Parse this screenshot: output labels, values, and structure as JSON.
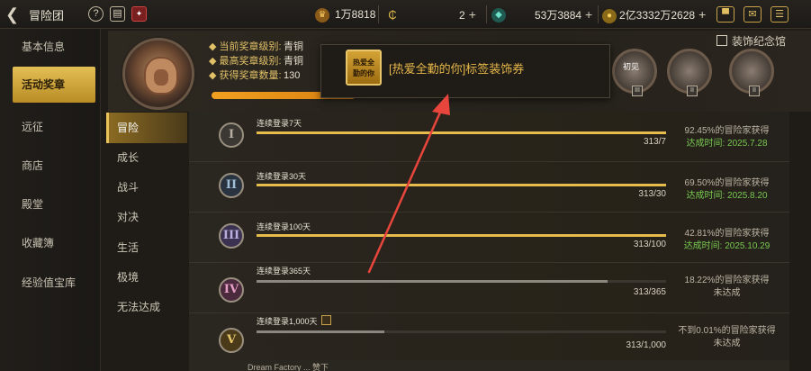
{
  "topbar": {
    "back_icon": "back-arrow-icon",
    "title": "冒险团",
    "help_glyph": "?",
    "book_glyph": "▤",
    "resources": [
      {
        "icon": "trophy-icon",
        "value": "1万8818",
        "color": "#e0a53a"
      },
      {
        "icon": "coin-c-icon",
        "glyph": "₵",
        "value": "2",
        "plus": "+",
        "color": "#d9b04a"
      },
      {
        "icon": "gem-icon",
        "value": "53万3884",
        "plus": "+",
        "color": "#3fb7a4"
      },
      {
        "icon": "gold-icon",
        "value": "2亿3332万2628",
        "plus": "+",
        "color": "#e0b33a"
      }
    ],
    "right_icons": [
      "treasure-icon",
      "mail-icon",
      "menu-icon"
    ]
  },
  "left_nav": {
    "items": [
      {
        "label": "基本信息"
      },
      {
        "label": "活动奖章",
        "active": true
      },
      {
        "label": "远征"
      },
      {
        "label": "商店"
      },
      {
        "label": "殿堂"
      },
      {
        "label": "收藏簿"
      },
      {
        "label": "经验值宝库"
      }
    ]
  },
  "header": {
    "current_rank_label": "当前奖章级别:",
    "current_rank_value": "青铜",
    "highest_rank_label": "最高奖章级别:",
    "highest_rank_value": "青铜",
    "count_label": "获得奖章数量:",
    "count_value": "130",
    "xp_progress": 1.0,
    "collection_link": "装饰纪念馆"
  },
  "medals": [
    {
      "pip": "III",
      "label": "初见"
    },
    {
      "pip": "II"
    },
    {
      "pip": "II"
    }
  ],
  "popup": {
    "icon_text_line1": "热爱全",
    "icon_text_line2": "勤的你",
    "text": "[热爱全勤的你]标签装饰券"
  },
  "sub_nav": {
    "items": [
      {
        "label": "冒险",
        "active": true
      },
      {
        "label": "成长"
      },
      {
        "label": "战斗"
      },
      {
        "label": "对决"
      },
      {
        "label": "生活"
      },
      {
        "label": "极境"
      },
      {
        "label": "无法达成"
      }
    ]
  },
  "achievements": [
    {
      "numeral": "I",
      "name": "连续登录7天",
      "progress": "313/7",
      "ratio": 1.0,
      "pct": "92.45%的冒险家获得",
      "date": "达成时间: 2025.7.28",
      "done": true,
      "badge_color": "#b8b0a0",
      "badge_bg": "#3b3833"
    },
    {
      "numeral": "II",
      "name": "连续登录30天",
      "progress": "313/30",
      "ratio": 1.0,
      "pct": "69.50%的冒险家获得",
      "date": "达成时间: 2025.8.20",
      "done": true,
      "badge_color": "#9fc0d8",
      "badge_bg": "#2a3440"
    },
    {
      "numeral": "III",
      "name": "连续登录100天",
      "progress": "313/100",
      "ratio": 1.0,
      "pct": "42.81%的冒险家获得",
      "date": "达成时间: 2025.10.29",
      "done": true,
      "badge_color": "#b9b0e0",
      "badge_bg": "#3a3250"
    },
    {
      "numeral": "IV",
      "name": "连续登录365天",
      "progress": "313/365",
      "ratio": 0.857,
      "pct": "18.22%的冒险家获得",
      "date": "未达成",
      "done": false,
      "badge_color": "#e8a0c8",
      "badge_bg": "#4a2a3c"
    },
    {
      "numeral": "V",
      "name": "连续登录1,000天",
      "progress": "313/1,000",
      "ratio": 0.313,
      "pct": "不到0.01%的冒险家获得",
      "date": "未达成",
      "done": false,
      "badge_color": "#e8c96a",
      "badge_bg": "#4a3a1a",
      "lock": true
    }
  ],
  "partial_row_text": "Dream Factory ... 赞下"
}
